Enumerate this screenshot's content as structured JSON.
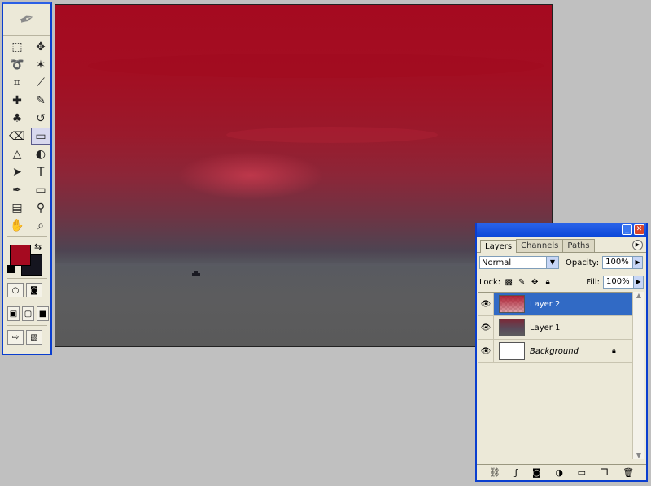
{
  "canvas": {
    "content": "red sunset sky over sea with small boat"
  },
  "toolbox": {
    "tools": [
      {
        "icon": "marquee-icon",
        "glyph": "⬚"
      },
      {
        "icon": "move-icon",
        "glyph": "✥"
      },
      {
        "icon": "lasso-icon",
        "glyph": "➰"
      },
      {
        "icon": "magic-wand-icon",
        "glyph": "✶"
      },
      {
        "icon": "crop-icon",
        "glyph": "⌗"
      },
      {
        "icon": "slice-icon",
        "glyph": "⟋"
      },
      {
        "icon": "healing-brush-icon",
        "glyph": "✚"
      },
      {
        "icon": "brush-icon",
        "glyph": "✎"
      },
      {
        "icon": "clone-stamp-icon",
        "glyph": "♣"
      },
      {
        "icon": "history-brush-icon",
        "glyph": "↺"
      },
      {
        "icon": "eraser-icon",
        "glyph": "⌫"
      },
      {
        "icon": "gradient-icon",
        "glyph": "▭"
      },
      {
        "icon": "blur-icon",
        "glyph": "△"
      },
      {
        "icon": "dodge-icon",
        "glyph": "◐"
      },
      {
        "icon": "path-selection-icon",
        "glyph": "➤"
      },
      {
        "icon": "type-icon",
        "glyph": "T"
      },
      {
        "icon": "pen-icon",
        "glyph": "✒"
      },
      {
        "icon": "rectangle-icon",
        "glyph": "▭"
      },
      {
        "icon": "notes-icon",
        "glyph": "▤"
      },
      {
        "icon": "eyedropper-icon",
        "glyph": "⚲"
      },
      {
        "icon": "hand-icon",
        "glyph": "✋"
      },
      {
        "icon": "zoom-icon",
        "glyph": "⌕"
      }
    ],
    "foreground_color": "#a50a20",
    "background_color": "#15151f"
  },
  "layers_panel": {
    "tabs": [
      "Layers",
      "Channels",
      "Paths"
    ],
    "blend_mode": "Normal",
    "opacity_label": "Opacity:",
    "opacity_value": "100%",
    "lock_label": "Lock:",
    "fill_label": "Fill:",
    "fill_value": "100%",
    "layers": [
      {
        "name": "Layer 2",
        "selected": true
      },
      {
        "name": "Layer 1",
        "selected": false
      },
      {
        "name": "Background",
        "selected": false,
        "locked": true
      }
    ]
  }
}
